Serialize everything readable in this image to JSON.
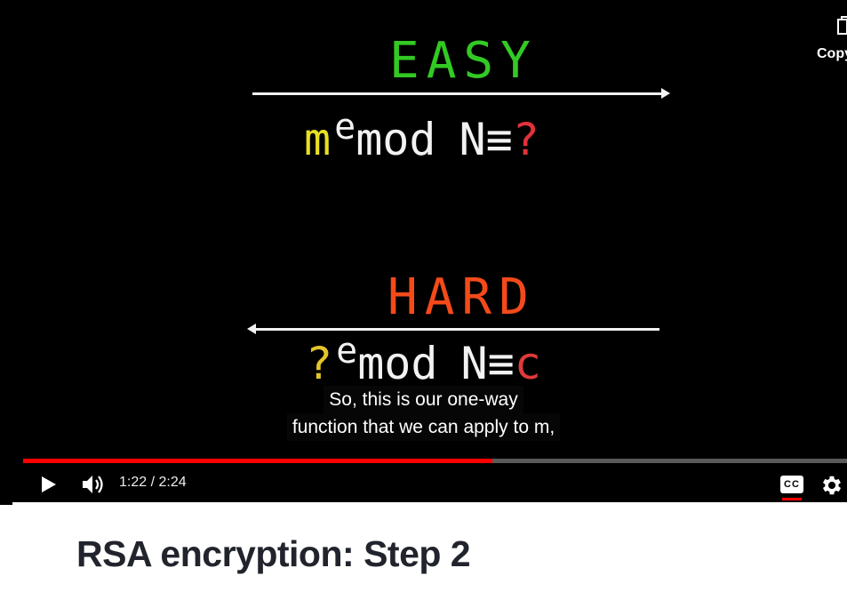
{
  "colors": {
    "easy": "#33c924",
    "hard": "#f44a1a",
    "equation": "#f2f2f2",
    "m": "#e8e023",
    "question_top": "#e0323a",
    "question_bottom": "#e3c42a",
    "c": "#e03a3a",
    "arrow": "#f2f2f2",
    "progress_played": "#ff0000",
    "cc_indicator": "#ff0000"
  },
  "slide": {
    "top_word": "EASY",
    "bottom_word": "HARD",
    "eq1": {
      "base": "m",
      "exp": "e",
      "mid": "mod",
      "modulus": "N",
      "rel": "≡",
      "result": "?"
    },
    "eq2": {
      "base": "?",
      "exp": "e",
      "mid": "mod",
      "modulus": "N",
      "rel": "≡",
      "result": "c"
    }
  },
  "captions": {
    "line1": "So, this is our one-way",
    "line2": "function that we can apply to m,"
  },
  "copy_button": {
    "label": "Copy",
    "icon": "copy-icon"
  },
  "player": {
    "current_time": "1:22",
    "duration": "2:24",
    "time_display": "1:22 / 2:24",
    "progress_fraction": 0.5694,
    "play_icon": "play-icon",
    "volume_icon": "volume-icon",
    "cc_icon": "closed-captions-icon",
    "cc_label": "CC",
    "settings_icon": "gear-icon"
  },
  "page": {
    "title": "RSA encryption: Step 2"
  }
}
